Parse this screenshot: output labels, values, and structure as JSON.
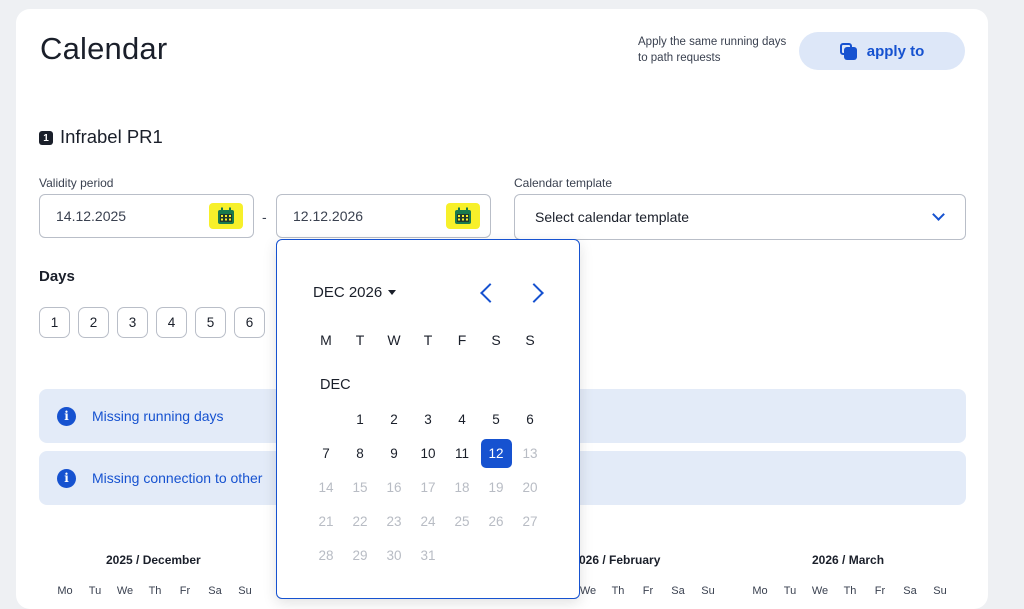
{
  "page": {
    "title": "Calendar"
  },
  "apply": {
    "note": "Apply the same running days to path requests",
    "button_label": "apply to",
    "icon": "copy-icon"
  },
  "path_request": {
    "badge": "1",
    "name": "Infrabel PR1"
  },
  "validity": {
    "label": "Validity period",
    "start": "14.12.2025",
    "separator": "-",
    "end": "12.12.2026",
    "icon": "calendar-icon",
    "highlight_color": "#f7f02a"
  },
  "template": {
    "label": "Calendar template",
    "placeholder": "Select calendar template"
  },
  "days": {
    "title": "Days",
    "items": [
      "1",
      "2",
      "3",
      "4",
      "5",
      "6"
    ]
  },
  "alerts": [
    {
      "icon": "info-icon",
      "text": "Missing running days"
    },
    {
      "icon": "info-icon",
      "text": "Missing connection to other"
    }
  ],
  "mini_calendars": [
    {
      "title": "2025 / December",
      "weekdays": [
        "Mo",
        "Tu",
        "We",
        "Th",
        "Fr",
        "Sa",
        "Su"
      ]
    },
    {
      "title": "026 / February",
      "weekdays": [
        "We",
        "Th",
        "Fr",
        "Sa",
        "Su"
      ]
    },
    {
      "title": "2026 / March",
      "weekdays": [
        "Mo",
        "Tu",
        "We",
        "Th",
        "Fr",
        "Sa",
        "Su"
      ]
    }
  ],
  "picker": {
    "month_label": "DEC 2026",
    "weekdays": [
      "M",
      "T",
      "W",
      "T",
      "F",
      "S",
      "S"
    ],
    "month_short": "DEC",
    "leading_blanks": 1,
    "days": [
      1,
      2,
      3,
      4,
      5,
      6,
      7,
      8,
      9,
      10,
      11,
      12,
      13,
      14,
      15,
      16,
      17,
      18,
      19,
      20,
      21,
      22,
      23,
      24,
      25,
      26,
      27,
      28,
      29,
      30,
      31
    ],
    "selected": 12,
    "last_enabled": 12
  },
  "colors": {
    "accent": "#1652d0",
    "alert_bg": "#e3ebf8",
    "button_bg": "#dde7f8"
  }
}
